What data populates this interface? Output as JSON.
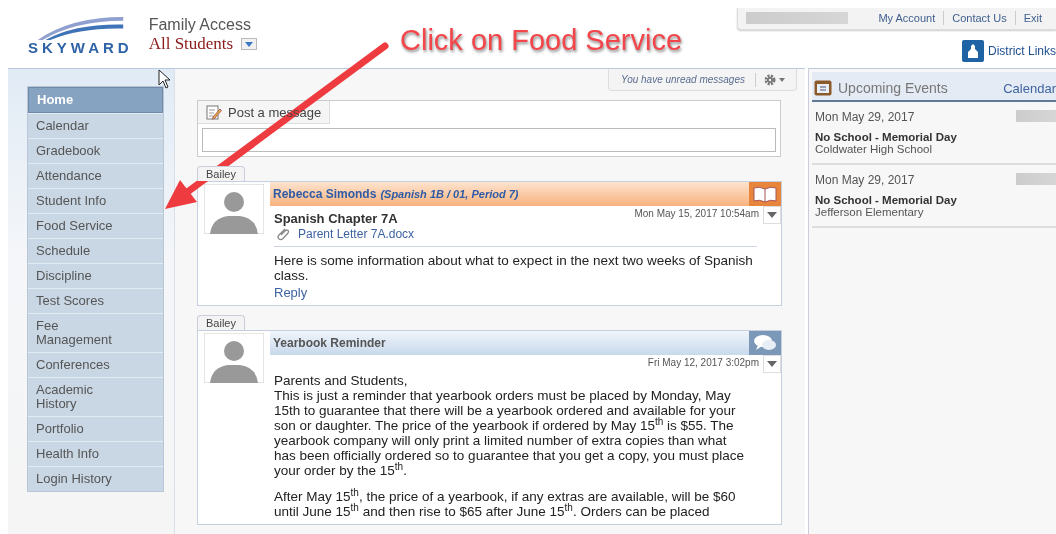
{
  "header": {
    "logo_text": "SKYWARD",
    "app_title": "Family Access",
    "student_selector": "All Students",
    "top_links": [
      "My Account",
      "Contact Us",
      "Exit"
    ],
    "district_links": "District Links"
  },
  "annotation": "Click on Food Service",
  "sidebar": {
    "items": [
      {
        "label": "Home",
        "selected": true
      },
      {
        "label": "Calendar",
        "selected": false
      },
      {
        "label": "Gradebook",
        "selected": false
      },
      {
        "label": "Attendance",
        "selected": false
      },
      {
        "label": "Student Info",
        "selected": false
      },
      {
        "label": "Food Service",
        "selected": false
      },
      {
        "label": "Schedule",
        "selected": false
      },
      {
        "label": "Discipline",
        "selected": false
      },
      {
        "label": "Test Scores",
        "selected": false
      },
      {
        "label": "Fee Management",
        "selected": false
      },
      {
        "label": "Conferences",
        "selected": false
      },
      {
        "label": "Academic History",
        "selected": false
      },
      {
        "label": "Portfolio",
        "selected": false
      },
      {
        "label": "Health Info",
        "selected": false
      },
      {
        "label": "Login History",
        "selected": false
      }
    ]
  },
  "notice": "You have unread messages",
  "post": {
    "label": "Post a message"
  },
  "messages": [
    {
      "student": "Bailey",
      "kind": "class",
      "sender": "Rebecca Simonds",
      "course": "(Spanish 1B / 01, Period 7)",
      "date": "Mon May 15, 2017 10:54am",
      "subject": "Spanish Chapter 7A",
      "attachment": "Parent Letter 7A.docx",
      "paragraphs": [
        [
          "Here is some information about what to expect in the next two weeks of Spanish class."
        ]
      ],
      "reply": "Reply"
    },
    {
      "student": "Bailey",
      "kind": "district",
      "title": "Yearbook Reminder",
      "date": "Fri May 12, 2017 3:02pm",
      "paragraphs": [
        [
          "Parents and Students,",
          "This is just a reminder that yearbook orders must be placed by Monday, May 15th to guarantee that there will be a yearbook ordered and available for your son or daughter.  The price of the yearbook if ordered by May 15$^{th}$ is $55.  The yearbook company will only print a limited number of extra copies than what has been officially ordered so to guarantee that you get a copy, you must place your order by the 15$^{th}$."
        ],
        [
          "After May 15$^{th}$, the price of a yearbook, if any extras are available, will be $60 until June 15$^{th}$ and then rise to $65 after June 15$^{th}$.  Orders can be placed"
        ]
      ]
    }
  ],
  "events": {
    "title": "Upcoming Events",
    "calendar_link": "Calendar",
    "items": [
      {
        "date": "Mon May 29, 2017",
        "title": "No School - Memorial Day",
        "location": "Coldwater High School"
      },
      {
        "date": "Mon May 29, 2017",
        "title": "No School - Memorial Day",
        "location": "Jefferson Elementary"
      }
    ]
  }
}
